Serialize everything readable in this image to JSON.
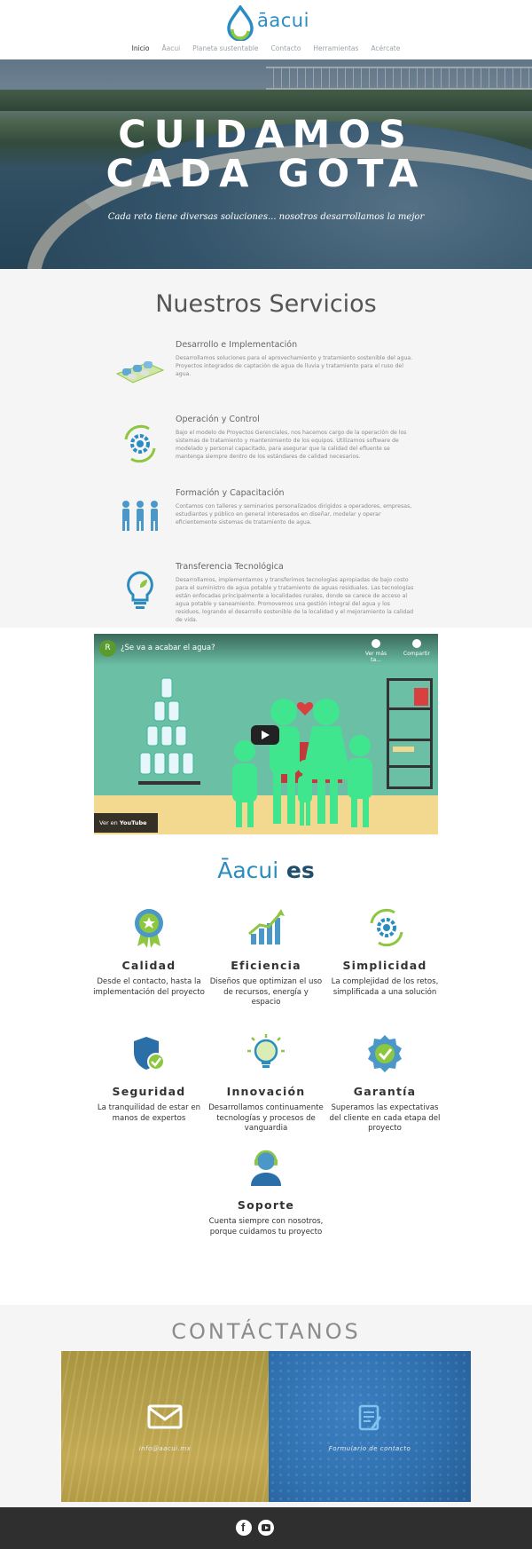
{
  "brand": {
    "name": "āacui",
    "primary": "#2a8cc0",
    "accent": "#8dc63f"
  },
  "nav": {
    "items": [
      {
        "label": "Inicio",
        "active": true
      },
      {
        "label": "Āacui",
        "active": false
      },
      {
        "label": "Planeta sustentable",
        "active": false
      },
      {
        "label": "Contacto",
        "active": false
      },
      {
        "label": "Herramientas",
        "active": false
      },
      {
        "label": "Acércate",
        "active": false
      }
    ]
  },
  "hero": {
    "line1": "CUIDAMOS",
    "line2": "CADA GOTA",
    "tagline": "Cada reto tiene diversas soluciones... nosotros desarrollamos la mejor"
  },
  "services": {
    "title": "Nuestros Servicios",
    "items": [
      {
        "icon": "water-filters-icon",
        "title": "Desarrollo e Implementación",
        "text": "Desarrollamos soluciones para el aprovechamiento y tratamiento sostenible del agua. Proyectos integrados de captación de agua de lluvia y tratamiento para el ruso del agua."
      },
      {
        "icon": "gear-cycle-icon",
        "title": "Operación y Control",
        "text": "Bajo el modelo de Proyectos Gerenciales, nos hacemos cargo de la operación de los sistemas de tratamiento y mantenimiento de los equipos. Utilizamos software de modelado y personal capacitado, para asegurar que la calidad del efluente se mantenga siempre dentro de los estándares de calidad necesarios."
      },
      {
        "icon": "people-icon",
        "title": "Formación y Capacitación",
        "text": "Contamos con talleres y seminarios personalizados dirigidos a operadores, empresas, estudiantes y público en general interesados en diseñar, modelar y operar eficientemente sistemas de tratamiento de agua."
      },
      {
        "icon": "leaf-bulb-icon",
        "title": "Transferencia Tecnológica",
        "text": "Desarrollamos, implementamos y transferimos tecnologías apropiadas de bajo costo para el suministro de agua potable y tratamiento de aguas residuales. Las tecnologías están enfocadas principalmente a localidades rurales, donde se carece de acceso al agua potable y saneamiento. Promovemos una gestión integral del agua y los residuos, logrando el desarrollo sostenible de la localidad y el mejoramiento la calidad de vida."
      }
    ]
  },
  "video": {
    "channel_initial": "R",
    "title": "¿Se va a acabar el agua?",
    "watch_later": "Ver más ta...",
    "share": "Compartir",
    "watch_on": "Ver en",
    "platform": "YouTube"
  },
  "aacui_es": {
    "title_brand": "Āacui",
    "title_rest": "es",
    "features": [
      {
        "icon": "quality-badge-icon",
        "title": "Calidad",
        "text": "Desde el contacto, hasta la implementación del proyecto"
      },
      {
        "icon": "growth-chart-icon",
        "title": "Eficiencia",
        "text": "Diseños que optimizan el uso de recursos, energía y espacio"
      },
      {
        "icon": "gear-cycle-icon",
        "title": "Simplicidad",
        "text": "La complejidad de los retos, simplificada a una solución"
      },
      {
        "icon": "shield-check-icon",
        "title": "Seguridad",
        "text": "La tranquilidad de estar en manos de expertos"
      },
      {
        "icon": "lightbulb-icon",
        "title": "Innovación",
        "text": "Desarrollamos continuamente tecnologías y procesos de vanguardia"
      },
      {
        "icon": "guarantee-seal-icon",
        "title": "Garantía",
        "text": "Superamos las expectativas del cliente en cada etapa del proyecto"
      },
      {
        "icon": "support-agent-icon",
        "title": "Soporte",
        "text": "Cuenta siempre con nosotros, porque cuidamos tu proyecto"
      }
    ]
  },
  "contact": {
    "title": "CONTÁCTANOS",
    "email_label": "info@aacui.mx",
    "form_label": "Formulario de contacto"
  },
  "footer": {
    "social": [
      "facebook-icon",
      "youtube-icon"
    ]
  }
}
